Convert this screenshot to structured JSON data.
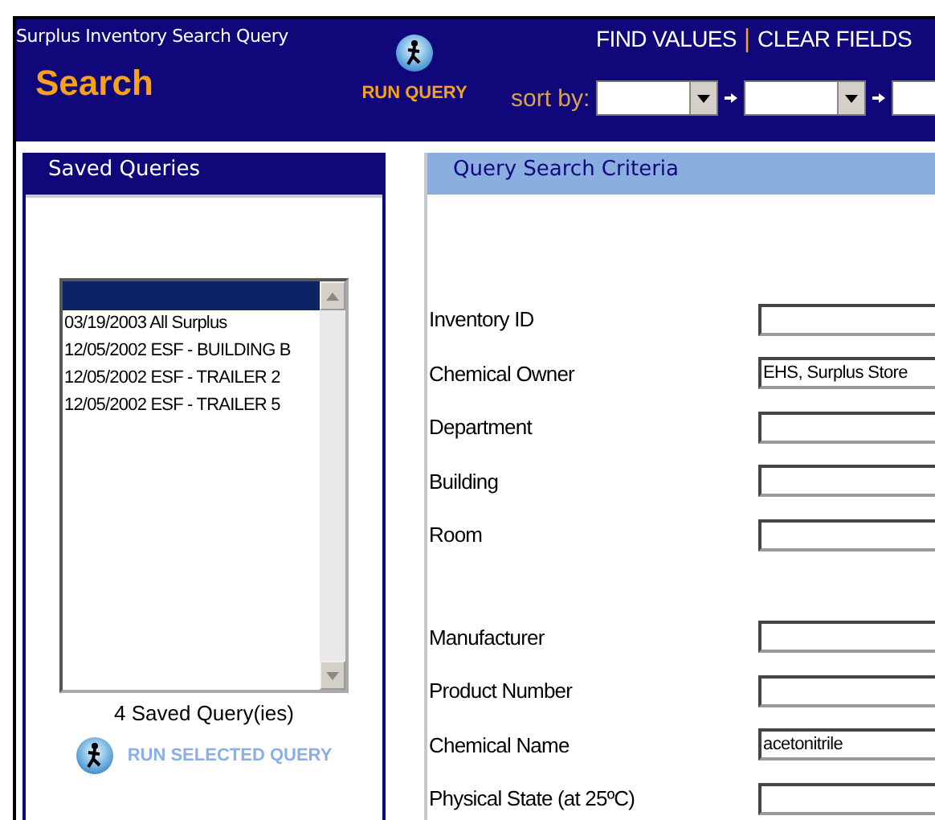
{
  "header": {
    "title": "Surplus Inventory Search Query",
    "heading": "Search",
    "run_query": "RUN QUERY",
    "links": [
      "FIND VALUES",
      "CLEAR FIELDS"
    ],
    "link_separator": "|",
    "sort_label": "sort by:"
  },
  "saved_queries": {
    "title": "Saved Queries",
    "blank_row_selected": true,
    "items": [
      {
        "label": "03/19/2003 All Surplus",
        "selected": false
      },
      {
        "label": "12/05/2002 ESF - BUILDING B",
        "selected": false
      },
      {
        "label": "12/05/2002 ESF - TRAILER 2",
        "selected": false
      },
      {
        "label": "12/05/2002 ESF - TRAILER 5",
        "selected": false
      }
    ],
    "count": "4 Saved Query(ies)",
    "run_selected": "RUN SELECTED QUERY"
  },
  "criteria": {
    "title": "Query Search Criteria",
    "groups": [
      [
        {
          "label": "Inventory ID"
        },
        {
          "label": "Chemical Owner",
          "value": "EHS, Surplus Store"
        },
        {
          "label": "Department"
        },
        {
          "label": "Building"
        },
        {
          "label": "Room"
        }
      ],
      [
        {
          "label": "Manufacturer"
        },
        {
          "label": "Product Number"
        },
        {
          "label": "Chemical Name",
          "value": "acetonitrile"
        },
        {
          "label": "Physical State (at 25ºC)"
        }
      ]
    ]
  }
}
